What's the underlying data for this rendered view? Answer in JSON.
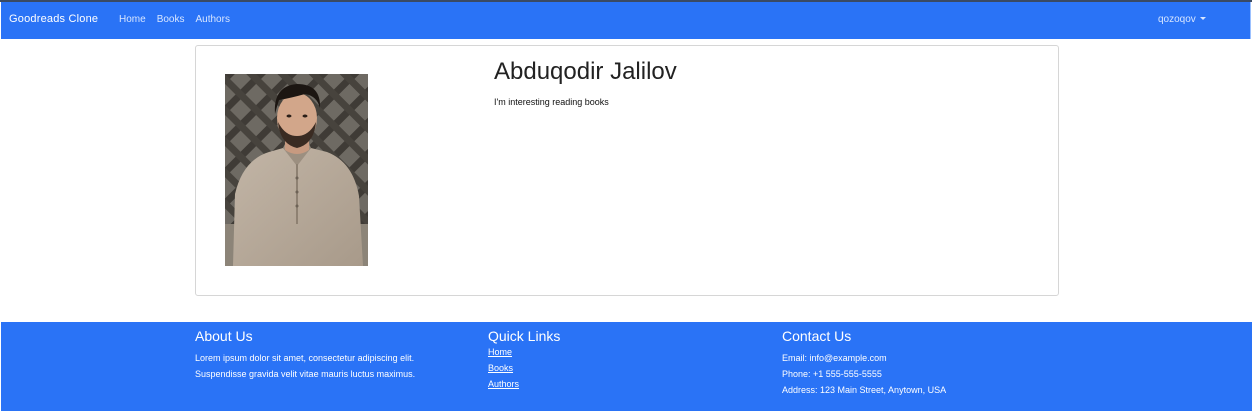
{
  "navbar": {
    "brand": "Goodreads Clone",
    "links": [
      {
        "label": "Home"
      },
      {
        "label": "Books"
      },
      {
        "label": "Authors"
      }
    ],
    "user": "qozoqov"
  },
  "author": {
    "name": "Abduqodir Jalilov",
    "bio": "I'm interesting reading books",
    "photo_icon": "author-photo"
  },
  "footer": {
    "about": {
      "title": "About Us",
      "lines": [
        "Lorem ipsum dolor sit amet, consectetur adipiscing elit.",
        "Suspendisse gravida velit vitae mauris luctus maximus."
      ]
    },
    "quick_links": {
      "title": "Quick Links",
      "items": [
        "Home",
        "Books",
        "Authors"
      ]
    },
    "contact": {
      "title": "Contact Us",
      "email": "Email: info@example.com",
      "phone": "Phone: +1 555-555-5555",
      "address": "Address: 123 Main Street, Anytown, USA"
    }
  },
  "colors": {
    "primary": "#2a73f6",
    "text_dark": "#222222",
    "border": "#d6d6d6"
  }
}
